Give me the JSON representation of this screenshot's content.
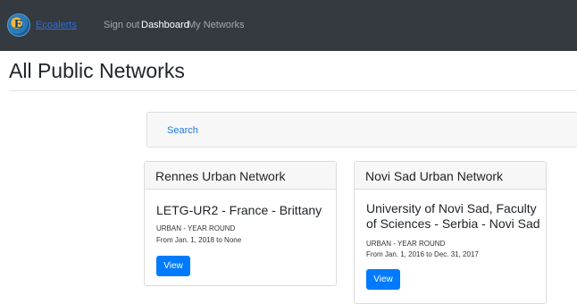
{
  "nav": {
    "brand_text": "Ecoalerts",
    "links": [
      "Sign out",
      "Dashboard",
      "My Networks"
    ]
  },
  "page": {
    "title": "All Public Networks"
  },
  "search": {
    "label": "Search"
  },
  "cards": [
    {
      "header": "Rennes Urban Network",
      "title": "LETG-UR2 - France - Brittany",
      "type": "URBAN - YEAR ROUND",
      "dates": "From Jan. 1, 2018 to None",
      "button": "View"
    },
    {
      "header": "Novi Sad Urban Network",
      "title": "University of Novi Sad, Faculty of Sciences - Serbia - Novi Sad",
      "type": "URBAN - YEAR ROUND",
      "dates": "From Jan. 1, 2016 to Dec. 31, 2017",
      "button": "View"
    }
  ],
  "colors": {
    "navbar": "#343a40",
    "primary": "#007bff",
    "link": "#1f7ae0"
  }
}
